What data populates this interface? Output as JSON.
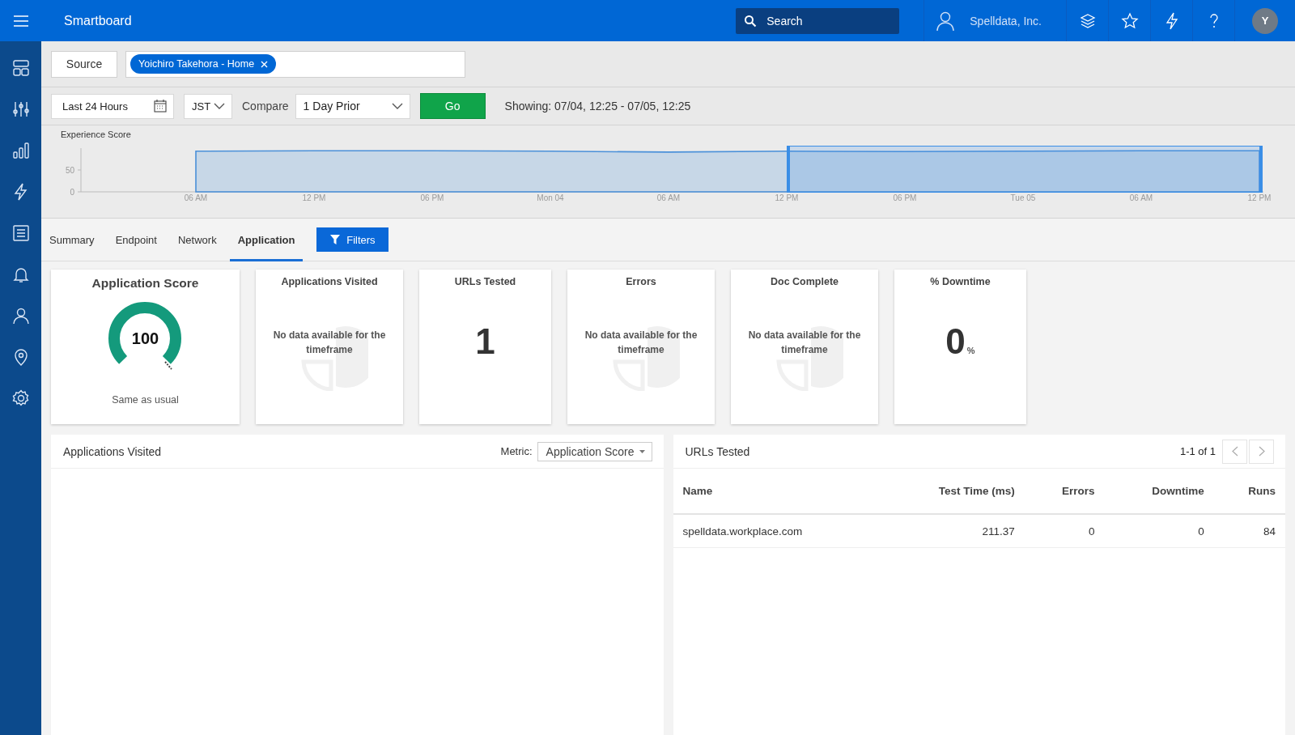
{
  "top_bar": {
    "title": "Smartboard",
    "search": {
      "placeholder": "Search"
    },
    "account": "Spelldata, Inc.",
    "avatar": "Y"
  },
  "sidebar": {
    "items": [
      {
        "kind": "layout"
      },
      {
        "kind": "sliders"
      },
      {
        "kind": "bars"
      },
      {
        "kind": "bolt"
      },
      {
        "kind": "list"
      },
      {
        "kind": "bell"
      },
      {
        "kind": "person"
      },
      {
        "kind": "pin"
      },
      {
        "kind": "gear"
      }
    ]
  },
  "source_bar": {
    "button": "Source",
    "tags": [
      {
        "label": "Yoichiro Takehora - Home"
      }
    ]
  },
  "time_bar": {
    "range": "Last 24 Hours",
    "timezone": "JST",
    "compare_label": "Compare",
    "compare": "1 Day Prior",
    "go": "Go",
    "showing": "Showing: 07/04, 12:25 - 07/05, 12:25"
  },
  "overview": {
    "range_selected": true,
    "chart_data": {
      "type": "area",
      "title": "Experience Score",
      "categories": [
        "06 AM",
        "12 PM",
        "06 PM",
        "Mon 04",
        "06 AM",
        "12 PM",
        "06 PM",
        "Tue 05",
        "06 AM",
        "12 PM"
      ],
      "series": [
        {
          "color": "#4a90d9",
          "values": [
            93,
            94,
            94,
            93,
            91,
            93,
            92,
            93,
            94,
            94
          ]
        }
      ],
      "ylim": [
        0,
        100
      ],
      "yticks": [
        0,
        50
      ]
    }
  },
  "tabs": [
    {
      "label": "Summary",
      "selected": false
    },
    {
      "label": "Endpoint",
      "selected": false
    },
    {
      "label": "Network",
      "selected": false
    },
    {
      "label": "Application",
      "selected": true
    }
  ],
  "filters_button": "Filters",
  "cards": [
    {
      "kind": "gauge",
      "title": "Application Score",
      "value": "100",
      "caption": "Same as usual"
    },
    {
      "kind": "empty",
      "title": "Applications Visited",
      "message": "No data available for the timeframe"
    },
    {
      "kind": "number",
      "title": "URLs Tested",
      "value": "1"
    },
    {
      "kind": "empty",
      "title": "Errors",
      "message": "No data available for the timeframe"
    },
    {
      "kind": "empty",
      "title": "Doc Complete",
      "message": "No data available for the timeframe"
    },
    {
      "kind": "percent",
      "title": "% Downtime",
      "value": "0",
      "unit": "%"
    }
  ],
  "applications_panel": {
    "title": "Applications Visited",
    "metric_label": "Metric:",
    "metric": "Application Score"
  },
  "urls_panel": {
    "title": "URLs Tested",
    "pagination": "1-1 of 1",
    "table": {
      "columns": [
        {
          "label": "Name"
        },
        {
          "label": "Test Time (ms)"
        },
        {
          "label": "Errors"
        },
        {
          "label": "Downtime"
        },
        {
          "label": "Runs"
        }
      ],
      "rows": [
        [
          "spelldata.workplace.com",
          "211.37",
          "0",
          "0",
          "84"
        ]
      ]
    }
  }
}
